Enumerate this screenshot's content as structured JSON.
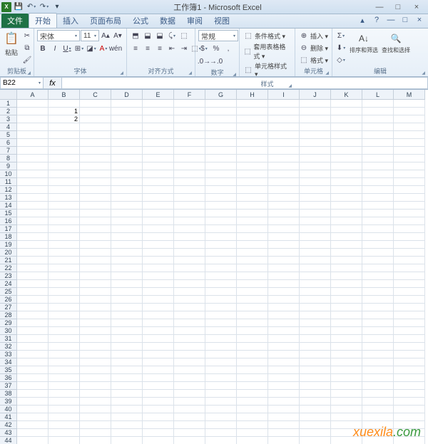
{
  "title": "工作簿1 - Microsoft Excel",
  "qat": {
    "save": "💾",
    "undo": "↶",
    "redo": "↷"
  },
  "winctrl": {
    "min": "—",
    "max": "□",
    "close": "×"
  },
  "tabs": [
    "文件",
    "开始",
    "插入",
    "页面布局",
    "公式",
    "数据",
    "审阅",
    "视图"
  ],
  "help": {
    "min": "▴",
    "h": "?",
    "wmin": "—",
    "wmax": "□",
    "wclose": "×"
  },
  "ribbon": {
    "clipboard": {
      "label": "剪贴板",
      "paste": "粘贴",
      "paste_ico": "📋"
    },
    "font": {
      "label": "字体",
      "name": "宋体",
      "size": "11",
      "btns": {
        "bold": "B",
        "italic": "I",
        "underline": "U",
        "border": "⊞",
        "fill": "◪",
        "color": "A"
      },
      "grow": "A▴",
      "shrink": "A▾"
    },
    "align": {
      "label": "对齐方式",
      "t": "⬒",
      "m": "⬓",
      "b": "⬓",
      "l": "≡",
      "c": "≡",
      "r": "≡",
      "ori": "⤹",
      "wrap": "⬚",
      "merge": "⬚",
      "outd": "⇤",
      "ind": "⇥"
    },
    "number": {
      "label": "数字",
      "format": "常规",
      "cur": "$",
      "pct": "%",
      "comma": ",",
      "inc": ".0→",
      "dec": "→.0"
    },
    "styles": {
      "label": "样式",
      "cond": "条件格式 ▾",
      "table": "套用表格格式 ▾",
      "cell": "单元格样式 ▾",
      "cond_ico": "⬚",
      "table_ico": "⬚",
      "cell_ico": "⬚"
    },
    "cells": {
      "label": "单元格",
      "insert": "插入 ▾",
      "delete": "删除 ▾",
      "format": "格式 ▾",
      "i_ico": "⊕",
      "d_ico": "⊖",
      "f_ico": "⬚"
    },
    "editing": {
      "label": "编辑",
      "sum": "Σ",
      "fill": "⬇",
      "clear": "◇",
      "sort": "排序和筛选",
      "find": "查找和选择",
      "sort_ico": "A↓",
      "find_ico": "🔍"
    }
  },
  "namebox": "B22",
  "fx_label": "fx",
  "columns": [
    "A",
    "B",
    "C",
    "D",
    "E",
    "F",
    "G",
    "H",
    "I",
    "J",
    "K",
    "L",
    "M"
  ],
  "rowcount": 44,
  "cells": {
    "B2": "1",
    "B3": "2"
  },
  "watermark": {
    "a": "xuexila",
    "b": ".com"
  }
}
